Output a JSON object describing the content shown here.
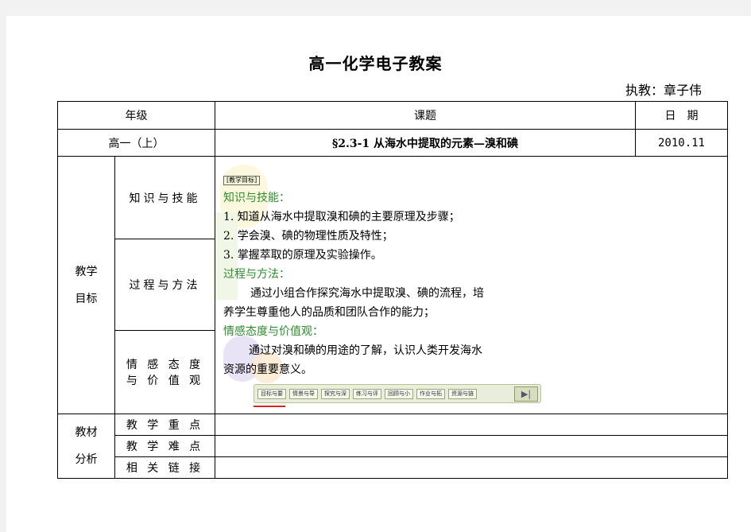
{
  "title": "高一化学电子教案",
  "author": "执教：章子伟",
  "header": {
    "grade_label": "年级",
    "topic_label": "课题",
    "date_label": "日　期"
  },
  "row1": {
    "grade": "高一（上）",
    "topic": "§2.3-1 从海水中提取的元素—溴和碘",
    "date": "2010.11"
  },
  "goals": {
    "label_line1": "教学",
    "label_line2": "目标",
    "sub1": "知识与技能",
    "sub2": "过程与方法",
    "sub3_line1": "情 感 态 度",
    "sub3_line2": "与 价 值 观"
  },
  "objectives": {
    "tag": "[教学目标]",
    "knowledge_head": "知识与技能：",
    "k1": "1. 知道从海水中提取溴和碘的主要原理及步骤；",
    "k2": "2. 学会溴、碘的物理性质及特性；",
    "k3": "3. 掌握萃取的原理及实验操作。",
    "process_head": "过程与方法：",
    "p1": "通过小组合作探究海水中提取溴、碘的流程，培",
    "p2": "养学生尊重他人的品质和团队合作的能力；",
    "emotion_head": "情感态度与价值观：",
    "e1": "通过对溴和碘的用途的了解，认识人类开发海水",
    "e2": "资源的重要意义。"
  },
  "nav": {
    "b1": "目标与要求",
    "b2": "情景与导入",
    "b3": "探究与深化",
    "b4": "练习与评价",
    "b5": "回顾与小结",
    "b6": "作业与拓展",
    "b7": "资源与链接",
    "play": "▶|"
  },
  "material": {
    "label_line1": "教材",
    "label_line2": "分析",
    "r1": "教 学 重 点",
    "r2": "教 学 难 点",
    "r3": "相 关 链 接",
    "v1": "",
    "v2": "",
    "v3": ""
  },
  "colors": {
    "heading_green": "#2e8b2e"
  }
}
